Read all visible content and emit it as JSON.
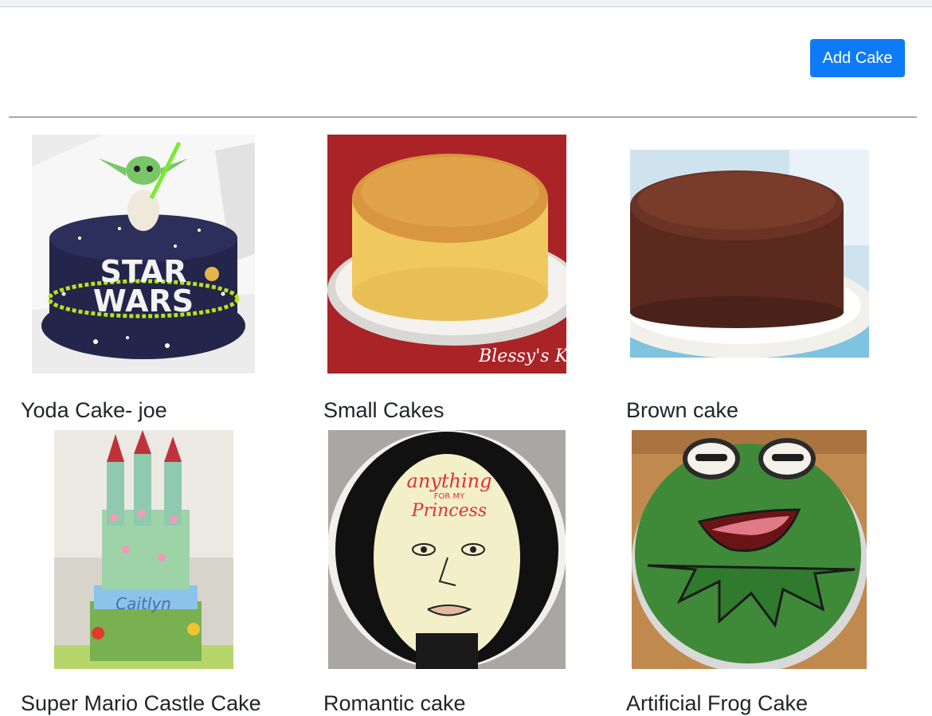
{
  "header": {
    "add_button_label": "Add Cake"
  },
  "cakes": [
    {
      "title": "Yoda Cake- joe",
      "image_text_lines": [
        "STAR",
        "WARS"
      ]
    },
    {
      "title": "Small Cakes",
      "image_text_lines": [
        "Blessy's Kit"
      ]
    },
    {
      "title": "Brown cake"
    },
    {
      "title": "Super Mario Castle Cake",
      "image_text_lines": [
        "Caitlyn"
      ]
    },
    {
      "title": "Romantic cake",
      "image_text_lines": [
        "anything",
        "FOR MY",
        "Princess"
      ]
    },
    {
      "title": "Artificial Frog Cake"
    }
  ],
  "colors": {
    "primary_button": "#0d7bf7",
    "divider": "#a9a9a9",
    "title_text": "#212529"
  }
}
